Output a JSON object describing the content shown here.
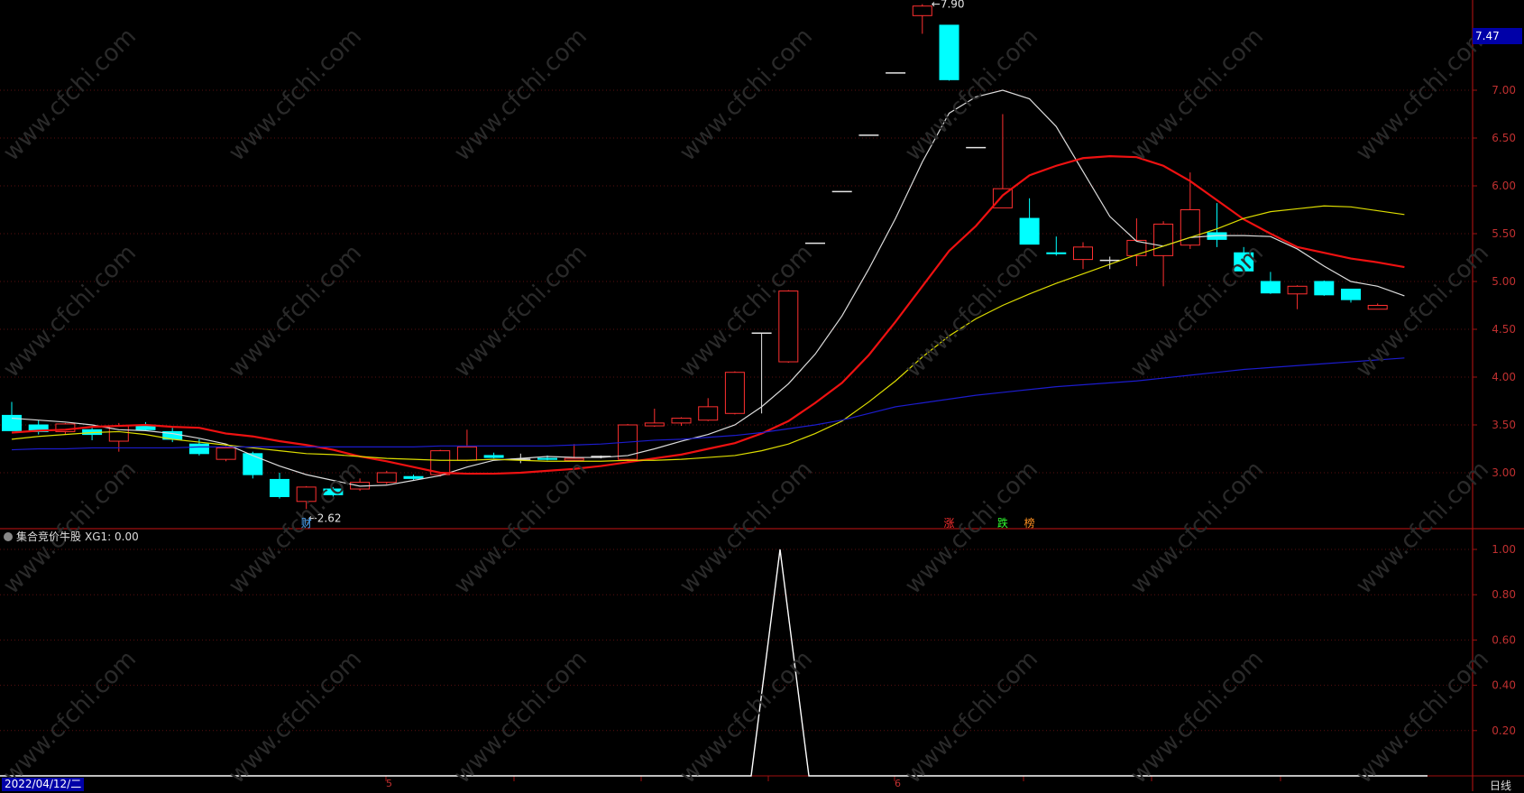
{
  "chart_data": [
    {
      "type": "candlestick",
      "price_axis_ticks": [
        "7.00",
        "6.50",
        "6.00",
        "5.50",
        "5.00",
        "4.50",
        "4.00",
        "3.50",
        "3.00"
      ],
      "last_price": "7.47",
      "high_label": "7.90",
      "low_label": "2.62",
      "ylim": [
        2.5,
        8.0
      ],
      "candles": [
        {
          "o": 3.6,
          "h": 3.74,
          "l": 3.45,
          "c": 3.44
        },
        {
          "o": 3.5,
          "h": 3.55,
          "l": 3.4,
          "c": 3.43
        },
        {
          "o": 3.43,
          "h": 3.52,
          "l": 3.4,
          "c": 3.51
        },
        {
          "o": 3.45,
          "h": 3.47,
          "l": 3.34,
          "c": 3.4
        },
        {
          "o": 3.33,
          "h": 3.52,
          "l": 3.22,
          "c": 3.49
        },
        {
          "o": 3.5,
          "h": 3.53,
          "l": 3.44,
          "c": 3.45
        },
        {
          "o": 3.43,
          "h": 3.47,
          "l": 3.32,
          "c": 3.35
        },
        {
          "o": 3.3,
          "h": 3.35,
          "l": 3.18,
          "c": 3.2
        },
        {
          "o": 3.14,
          "h": 3.28,
          "l": 3.12,
          "c": 3.26
        },
        {
          "o": 3.2,
          "h": 3.22,
          "l": 2.94,
          "c": 2.98
        },
        {
          "o": 2.93,
          "h": 3.0,
          "l": 2.73,
          "c": 2.75
        },
        {
          "o": 2.7,
          "h": 2.86,
          "l": 2.62,
          "c": 2.85
        },
        {
          "o": 2.83,
          "h": 2.85,
          "l": 2.75,
          "c": 2.77
        },
        {
          "o": 2.83,
          "h": 2.94,
          "l": 2.81,
          "c": 2.9
        },
        {
          "o": 2.9,
          "h": 3.02,
          "l": 2.88,
          "c": 3.0
        },
        {
          "o": 2.96,
          "h": 2.98,
          "l": 2.92,
          "c": 2.94
        },
        {
          "o": 2.98,
          "h": 3.24,
          "l": 2.96,
          "c": 3.23
        },
        {
          "o": 3.13,
          "h": 3.45,
          "l": 3.12,
          "c": 3.27
        },
        {
          "o": 3.18,
          "h": 3.21,
          "l": 3.15,
          "c": 3.16
        },
        {
          "o": 3.14,
          "h": 3.2,
          "l": 3.1,
          "c": 3.14
        },
        {
          "o": 3.15,
          "h": 3.18,
          "l": 3.13,
          "c": 3.14
        },
        {
          "o": 3.13,
          "h": 3.3,
          "l": 3.12,
          "c": 3.15
        },
        {
          "o": 3.17,
          "h": 3.18,
          "l": 3.15,
          "c": 3.17
        },
        {
          "o": 3.14,
          "h": 3.51,
          "l": 3.12,
          "c": 3.5
        },
        {
          "o": 3.49,
          "h": 3.67,
          "l": 3.48,
          "c": 3.52
        },
        {
          "o": 3.52,
          "h": 3.58,
          "l": 3.49,
          "c": 3.57
        },
        {
          "o": 3.55,
          "h": 3.78,
          "l": 3.54,
          "c": 3.69
        },
        {
          "o": 3.62,
          "h": 4.06,
          "l": 3.61,
          "c": 4.05
        },
        {
          "o": 4.46,
          "h": 4.46,
          "l": 3.62,
          "c": 4.46
        },
        {
          "o": 4.16,
          "h": 4.91,
          "l": 4.15,
          "c": 4.9
        },
        {
          "o": 5.4,
          "h": 5.4,
          "l": 5.4,
          "c": 5.4
        },
        {
          "o": 5.94,
          "h": 5.94,
          "l": 5.94,
          "c": 5.94
        },
        {
          "o": 6.53,
          "h": 6.53,
          "l": 6.53,
          "c": 6.53
        },
        {
          "o": 7.18,
          "h": 7.18,
          "l": 7.18,
          "c": 7.18
        },
        {
          "o": 7.78,
          "h": 7.9,
          "l": 7.59,
          "c": 7.88
        },
        {
          "o": 7.68,
          "h": 7.68,
          "l": 7.1,
          "c": 7.11
        },
        {
          "o": 6.4,
          "h": 6.4,
          "l": 6.4,
          "c": 6.4
        },
        {
          "o": 5.77,
          "h": 6.75,
          "l": 5.77,
          "c": 5.97
        },
        {
          "o": 5.66,
          "h": 5.87,
          "l": 5.4,
          "c": 5.39
        },
        {
          "o": 5.3,
          "h": 5.47,
          "l": 5.27,
          "c": 5.29
        },
        {
          "o": 5.23,
          "h": 5.41,
          "l": 5.13,
          "c": 5.36
        },
        {
          "o": 5.22,
          "h": 5.26,
          "l": 5.13,
          "c": 5.22
        },
        {
          "o": 5.27,
          "h": 5.66,
          "l": 5.16,
          "c": 5.43
        },
        {
          "o": 5.27,
          "h": 5.63,
          "l": 4.95,
          "c": 5.6
        },
        {
          "o": 5.38,
          "h": 6.14,
          "l": 5.34,
          "c": 5.75
        },
        {
          "o": 5.51,
          "h": 5.82,
          "l": 5.36,
          "c": 5.44
        },
        {
          "o": 5.3,
          "h": 5.36,
          "l": 5.1,
          "c": 5.11
        },
        {
          "o": 5.0,
          "h": 5.1,
          "l": 4.87,
          "c": 4.88
        },
        {
          "o": 4.87,
          "h": 4.96,
          "l": 4.71,
          "c": 4.95
        },
        {
          "o": 5.0,
          "h": 5.01,
          "l": 4.85,
          "c": 4.86
        },
        {
          "o": 4.92,
          "h": 4.92,
          "l": 4.78,
          "c": 4.81
        },
        {
          "o": 4.71,
          "h": 4.77,
          "l": 4.71,
          "c": 4.75
        }
      ],
      "ma_lines": [
        {
          "color": "#dcdcdc",
          "values": [
            3.57,
            3.55,
            3.53,
            3.5,
            3.45,
            3.44,
            3.41,
            3.36,
            3.3,
            3.18,
            3.07,
            2.98,
            2.92,
            2.86,
            2.87,
            2.92,
            2.97,
            3.06,
            3.13,
            3.15,
            3.17,
            3.16,
            3.16,
            3.18,
            3.25,
            3.33,
            3.4,
            3.5,
            3.69,
            3.93,
            4.24,
            4.64,
            5.13,
            5.66,
            6.25,
            6.76,
            6.93,
            7.0,
            6.91,
            6.62,
            6.15,
            5.68,
            5.42,
            5.37,
            5.46,
            5.48,
            5.48,
            5.47,
            5.34,
            5.16,
            5.0,
            4.95,
            4.85
          ]
        },
        {
          "color": "#ee1111",
          "values": [
            3.42,
            3.44,
            3.45,
            3.48,
            3.49,
            3.5,
            3.48,
            3.47,
            3.41,
            3.38,
            3.33,
            3.29,
            3.24,
            3.17,
            3.12,
            3.06,
            3.0,
            2.99,
            2.99,
            3.0,
            3.02,
            3.04,
            3.07,
            3.11,
            3.15,
            3.19,
            3.25,
            3.31,
            3.41,
            3.54,
            3.73,
            3.94,
            4.23,
            4.58,
            4.95,
            5.32,
            5.58,
            5.9,
            6.11,
            6.21,
            6.29,
            6.31,
            6.3,
            6.21,
            6.05,
            5.85,
            5.65,
            5.5,
            5.36,
            5.3,
            5.24,
            5.2,
            5.15
          ]
        },
        {
          "color": "#dddd00",
          "values": [
            3.35,
            3.38,
            3.4,
            3.42,
            3.43,
            3.4,
            3.35,
            3.32,
            3.29,
            3.26,
            3.23,
            3.2,
            3.19,
            3.17,
            3.15,
            3.14,
            3.13,
            3.13,
            3.14,
            3.13,
            3.12,
            3.12,
            3.12,
            3.13,
            3.13,
            3.14,
            3.16,
            3.18,
            3.23,
            3.3,
            3.41,
            3.54,
            3.74,
            3.96,
            4.21,
            4.43,
            4.61,
            4.75,
            4.87,
            4.98,
            5.08,
            5.18,
            5.28,
            5.37,
            5.46,
            5.55,
            5.66,
            5.73,
            5.76,
            5.79,
            5.78,
            5.74,
            5.7
          ]
        },
        {
          "color": "#1c1ccc",
          "values": [
            3.24,
            3.25,
            3.25,
            3.26,
            3.26,
            3.26,
            3.26,
            3.27,
            3.27,
            3.27,
            3.27,
            3.27,
            3.27,
            3.27,
            3.27,
            3.27,
            3.28,
            3.28,
            3.28,
            3.28,
            3.28,
            3.29,
            3.3,
            3.32,
            3.34,
            3.35,
            3.37,
            3.39,
            3.42,
            3.46,
            3.5,
            3.55,
            3.62,
            3.69,
            3.73,
            3.77,
            3.81,
            3.84,
            3.87,
            3.9,
            3.92,
            3.94,
            3.96,
            3.99,
            4.02,
            4.05,
            4.08,
            4.1,
            4.12,
            4.14,
            4.16,
            4.18,
            4.2
          ]
        }
      ]
    },
    {
      "type": "line",
      "title": "集合竞价牛股",
      "value_label": "XG1: 0.00",
      "yticks": [
        "1.00",
        "0.80",
        "0.60",
        "0.40",
        "0.20"
      ],
      "ylim": [
        0,
        1
      ],
      "values": [
        0,
        0,
        0,
        0,
        0,
        0,
        0,
        0,
        0,
        0,
        0,
        0,
        0,
        0,
        0,
        0,
        0,
        0,
        0,
        0,
        0,
        0,
        0,
        0,
        0,
        0,
        0,
        0,
        0,
        1,
        0,
        0,
        0,
        0,
        0,
        0,
        0,
        0,
        0,
        0,
        0,
        0,
        0,
        0,
        0,
        0,
        0,
        0,
        0,
        0,
        0,
        0,
        0
      ]
    }
  ],
  "date_label": "2022/04/12/二",
  "period_label": "日线",
  "x_labels": [
    "5",
    "6"
  ],
  "signals": [
    {
      "text": "财",
      "color": "#4aa8ff",
      "idx": 11
    },
    {
      "text": "涨",
      "color": "#ff3030",
      "idx": 35
    },
    {
      "text": "跌",
      "color": "#30ff30",
      "idx": 37
    },
    {
      "text": "榜",
      "color": "#ff9020",
      "idx": 38
    }
  ],
  "watermark": "www.cfchi.com"
}
